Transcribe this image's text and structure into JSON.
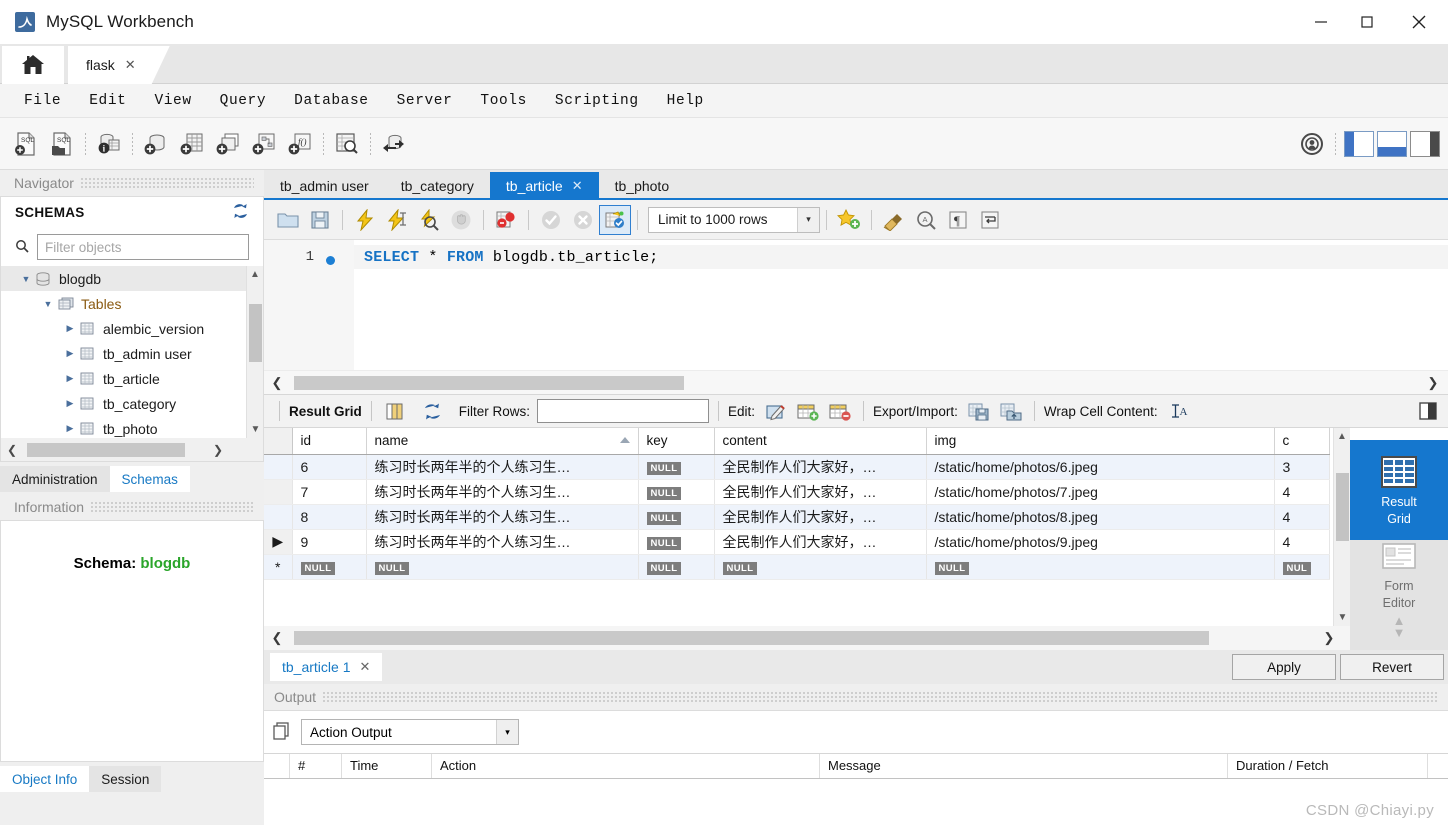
{
  "window": {
    "title": "MySQL Workbench",
    "logo_icon": "mysql-dolphin-icon",
    "minimize_label": "—",
    "maximize_label": "☐",
    "close_label": "✕"
  },
  "app_tabs": {
    "home_icon": "home-icon",
    "items": [
      {
        "label": "flask",
        "close": "✕",
        "active": true
      }
    ]
  },
  "menu": {
    "items": [
      "File",
      "Edit",
      "View",
      "Query",
      "Database",
      "Server",
      "Tools",
      "Scripting",
      "Help"
    ]
  },
  "main_toolbar": {
    "buttons": [
      {
        "name": "new-sql-tab-icon",
        "title": "SQL"
      },
      {
        "name": "open-sql-script-icon",
        "title": "SQL"
      },
      {
        "name": "schema-inspector-icon",
        "title": "i"
      },
      {
        "name": "create-schema-icon",
        "title": ""
      },
      {
        "name": "create-table-icon",
        "title": ""
      },
      {
        "name": "create-view-icon",
        "title": ""
      },
      {
        "name": "create-procedure-icon",
        "title": ""
      },
      {
        "name": "create-function-icon",
        "title": "f()"
      },
      {
        "name": "search-data-icon",
        "title": ""
      },
      {
        "name": "reconnect-server-icon",
        "title": ""
      }
    ],
    "right_buttons": [
      {
        "name": "server-status-icon"
      },
      {
        "name": "toggle-sidebar-icon"
      },
      {
        "name": "toggle-output-icon"
      },
      {
        "name": "toggle-secondary-sidebar-icon"
      }
    ]
  },
  "navigator": {
    "caption": "Navigator",
    "section_title": "SCHEMAS",
    "refresh_icon": "refresh-icon",
    "search_icon": "search-icon",
    "filter_placeholder": "Filter objects",
    "tree": [
      {
        "label": "blogdb",
        "depth": 0,
        "icon": "schema-icon",
        "expanded": true,
        "selected": true
      },
      {
        "label": "Tables",
        "depth": 1,
        "icon": "folder-tables-icon",
        "expanded": true,
        "selected": false
      },
      {
        "label": "alembic_version",
        "depth": 2,
        "icon": "table-icon",
        "expanded": false,
        "selected": false
      },
      {
        "label": "tb_admin user",
        "depth": 2,
        "icon": "table-icon",
        "expanded": false,
        "selected": false
      },
      {
        "label": "tb_article",
        "depth": 2,
        "icon": "table-icon",
        "expanded": false,
        "selected": false
      },
      {
        "label": "tb_category",
        "depth": 2,
        "icon": "table-icon",
        "expanded": false,
        "selected": false
      },
      {
        "label": "tb_photo",
        "depth": 2,
        "icon": "table-icon",
        "expanded": false,
        "selected": false
      }
    ],
    "tabs": [
      {
        "label": "Administration",
        "active": false
      },
      {
        "label": "Schemas",
        "active": true
      }
    ]
  },
  "information": {
    "caption": "Information",
    "schema_label": "Schema:",
    "schema_value": "blogdb",
    "schema_value_color": "#2aa52a",
    "tabs": [
      {
        "label": "Object Info",
        "active": true
      },
      {
        "label": "Session",
        "active": false
      }
    ]
  },
  "sql_tabs": {
    "items": [
      {
        "label": "tb_admin user",
        "active": false,
        "closable": false
      },
      {
        "label": "tb_category",
        "active": false,
        "closable": false
      },
      {
        "label": "tb_article",
        "active": true,
        "closable": true,
        "close": "✕"
      },
      {
        "label": "tb_photo",
        "active": false,
        "closable": false
      }
    ]
  },
  "query_toolbar": {
    "buttons": [
      {
        "name": "open-script-icon"
      },
      {
        "name": "save-script-icon"
      },
      {
        "name": "execute-icon"
      },
      {
        "name": "execute-current-statement-icon"
      },
      {
        "name": "explain-query-icon"
      },
      {
        "name": "stop-query-icon"
      },
      {
        "name": "toggle-stop-on-error-icon"
      },
      {
        "name": "commit-icon"
      },
      {
        "name": "rollback-icon"
      },
      {
        "name": "toggle-autocommit-icon",
        "active": true
      },
      {
        "name": "add-snippet-icon"
      },
      {
        "name": "beautify-query-icon"
      },
      {
        "name": "find-icon"
      },
      {
        "name": "toggle-invisible-chars-icon"
      },
      {
        "name": "toggle-word-wrap-icon"
      }
    ],
    "limit_label": "Limit to 1000 rows",
    "limit_caret": "▾"
  },
  "editor": {
    "line_number": "1",
    "code_keyword_1": "SELECT",
    "code_star": " * ",
    "code_keyword_2": "FROM",
    "code_rest": " blogdb.tb_article;"
  },
  "result_toolbar": {
    "title": "Result Grid",
    "grid_view_icon": "grid-columns-icon",
    "refresh_icon": "refresh-icon",
    "filter_label": "Filter Rows:",
    "filter_value": "",
    "edit_label": "Edit:",
    "edit_icons": [
      "edit-row-icon",
      "insert-row-icon",
      "delete-row-icon"
    ],
    "export_label": "Export/Import:",
    "export_icons": [
      "export-recordset-icon",
      "import-recordset-icon"
    ],
    "wrap_label": "Wrap Cell Content:",
    "wrap_icon": "wrap-text-icon",
    "panel_toggle_icon": "toggle-field-panel-icon"
  },
  "grid": {
    "columns": [
      "id",
      "name",
      "key",
      "content",
      "img",
      "c"
    ],
    "sorted_column": "name",
    "sort_direction": "asc",
    "null_text": "NULL",
    "rows": [
      {
        "marker": "",
        "id": "6",
        "name": "练习时长两年半的个人练习生…",
        "key": "NULL",
        "content": "全民制作人们大家好，…",
        "img": "/static/home/photos/6.jpeg",
        "c": "3"
      },
      {
        "marker": "",
        "id": "7",
        "name": "练习时长两年半的个人练习生…",
        "key": "NULL",
        "content": "全民制作人们大家好，…",
        "img": "/static/home/photos/7.jpeg",
        "c": "4"
      },
      {
        "marker": "",
        "id": "8",
        "name": "练习时长两年半的个人练习生…",
        "key": "NULL",
        "content": "全民制作人们大家好，…",
        "img": "/static/home/photos/8.jpeg",
        "c": "4"
      },
      {
        "marker": "▶",
        "id": "9",
        "name": "练习时长两年半的个人练习生…",
        "key": "NULL",
        "content": "全民制作人们大家好，…",
        "img": "/static/home/photos/9.jpeg",
        "c": "4"
      },
      {
        "marker": "*",
        "id": "NULL",
        "name": "NULL",
        "key": "NULL",
        "content": "NULL",
        "img": "NULL",
        "c": "NUL"
      }
    ]
  },
  "side_switcher": {
    "items": [
      {
        "label": "Result\nGrid",
        "label_line1": "Result",
        "label_line2": "Grid",
        "icon": "result-grid-icon",
        "active": true
      },
      {
        "label": "Form\nEditor",
        "label_line1": "Form",
        "label_line2": "Editor",
        "icon": "form-editor-icon",
        "active": false
      }
    ],
    "up_arrow": "▲",
    "down_arrow": "▼"
  },
  "result_footer": {
    "tab_label": "tb_article 1",
    "tab_close": "✕",
    "apply_label": "Apply",
    "revert_label": "Revert"
  },
  "output": {
    "caption": "Output",
    "copy_icon": "copy-icon",
    "selected": "Action Output",
    "caret": "▾",
    "columns": [
      "#",
      "Time",
      "Action",
      "Message",
      "Duration / Fetch"
    ]
  },
  "watermark": "CSDN @Chiayi.py",
  "colors": {
    "accent": "#1577ce",
    "tab_active_bg": "#1577ce",
    "keyword": "#1672c4",
    "schema_green": "#2aa52a",
    "null_badge": "#7d7d7d"
  }
}
